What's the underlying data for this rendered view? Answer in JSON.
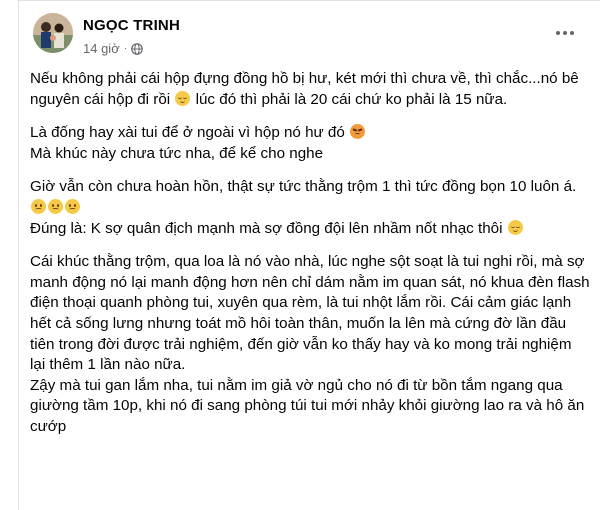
{
  "post": {
    "author": "NGỌC TRINH",
    "time": "14 giờ",
    "separator": "·",
    "privacy_icon": "globe-icon",
    "paragraphs": [
      {
        "segments": [
          {
            "t": "Nếu không phải cái hộp đựng đồng hồ bị hư, két mới thì chưa về, thì chắc...nó bê nguyên cái hộp đi rồi "
          },
          {
            "emoji": "relieved-face-icon"
          },
          {
            "t": " lúc đó thì phải là 20 cái chứ ko phải là 15 nữa."
          }
        ]
      },
      {
        "segments": [
          {
            "t": "Là đống hay xài tui để ở ngoài vì hộp nó hư đó "
          },
          {
            "emoji": "pouting-face-icon"
          },
          {
            "br": true
          },
          {
            "t": "Mà khúc này chưa tức nha, để kể cho nghe"
          }
        ]
      },
      {
        "segments": [
          {
            "t": "Giờ vẫn còn chưa hoàn hồn, thật sự tức thằng trộm 1 thì tức đồng bọn 10 luôn á."
          },
          {
            "emoji": "sad-face-icon"
          },
          {
            "emoji": "sad-face-icon"
          },
          {
            "emoji": "sad-face-icon"
          },
          {
            "br": true
          },
          {
            "t": "Đúng là: K sợ quân địch mạnh mà sợ đồng đội lên nhầm nốt nhạc thôi "
          },
          {
            "emoji": "relieved-face-icon"
          }
        ]
      },
      {
        "segments": [
          {
            "t": "Cái khúc thằng trộm, qua loa là nó vào nhà, lúc nghe sột soạt là tui nghi rồi, mà sợ manh động nó lại manh động hơn nên chỉ dám nằm im quan sát, nó khua đèn flash điện thoại quanh phòng tui, xuyên qua rèm, là tui nhột lắm rồi. Cái cảm giác lạnh hết cả sống lưng nhưng toát mồ hôi toàn thân, muốn la lên mà cứng đờ lần đầu tiên trong đời được trải nghiệm, đến giờ vẫn ko thấy hay và ko mong trải nghiệm lại thêm 1 lần nào nữa."
          },
          {
            "br": true
          },
          {
            "t": "Zậy mà tui gan lắm nha, tui nằm im giả vờ ngủ cho nó đi từ bồn tắm ngang qua giường tầm 10p, khi nó đi sang phòng túi tui mới nhảy khỏi giường lao ra và hô ăn cướp"
          }
        ]
      }
    ]
  },
  "colors": {
    "text": "#050505",
    "meta": "#65676b",
    "border": "#dfe1e5"
  }
}
